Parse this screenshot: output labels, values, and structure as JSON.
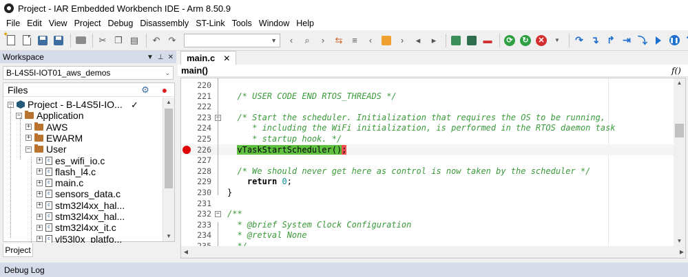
{
  "window": {
    "title": "Project - IAR Embedded Workbench IDE - Arm 8.50.9"
  },
  "menu": {
    "items": [
      "File",
      "Edit",
      "View",
      "Project",
      "Debug",
      "Disassembly",
      "ST-Link",
      "Tools",
      "Window",
      "Help"
    ]
  },
  "toolbar": {
    "combo_value": "",
    "icons": [
      "new-file-icon",
      "open-file-icon",
      "save-icon",
      "save-all-icon",
      "print-icon",
      "cut-icon",
      "copy-icon",
      "paste-icon",
      "undo-icon",
      "redo-icon",
      "find-icon",
      "replace-icon",
      "navigate-back-icon",
      "bookmark-icon",
      "build-icon",
      "compile-icon",
      "debug-icon",
      "go-icon",
      "stop-icon",
      "step-over-icon",
      "step-into-icon",
      "step-out-icon",
      "run-to-cursor-icon",
      "pause-icon"
    ]
  },
  "workspace": {
    "title": "Workspace",
    "config": "B-L4S5I-IOT01_aws_demos",
    "files_label": "Files",
    "tab": "Project",
    "tree": [
      {
        "label": "Project - B-L4S5I-IO...",
        "type": "project",
        "expander": "−",
        "depth": 0
      },
      {
        "label": "Application",
        "type": "folder",
        "expander": "−",
        "depth": 1
      },
      {
        "label": "AWS",
        "type": "folder",
        "expander": "+",
        "depth": 2
      },
      {
        "label": "EWARM",
        "type": "folder",
        "expander": "+",
        "depth": 2
      },
      {
        "label": "User",
        "type": "folder",
        "expander": "−",
        "depth": 2
      },
      {
        "label": "es_wifi_io.c",
        "type": "file",
        "expander": "+",
        "depth": 3
      },
      {
        "label": "flash_l4.c",
        "type": "file",
        "expander": "+",
        "depth": 3
      },
      {
        "label": "main.c",
        "type": "file",
        "expander": "+",
        "depth": 3
      },
      {
        "label": "sensors_data.c",
        "type": "file",
        "expander": "+",
        "depth": 3
      },
      {
        "label": "stm32l4xx_hal...",
        "type": "file",
        "expander": "+",
        "depth": 3
      },
      {
        "label": "stm32l4xx_hal...",
        "type": "file",
        "expander": "+",
        "depth": 3
      },
      {
        "label": "stm32l4xx_it.c",
        "type": "file",
        "expander": "+",
        "depth": 3
      },
      {
        "label": "vl53l0x_platfo...",
        "type": "file",
        "expander": "+",
        "depth": 3
      }
    ]
  },
  "editor": {
    "tab_label": "main.c",
    "function_name": "main()",
    "function_icon": "f()",
    "lines": [
      {
        "num": "220",
        "text": ""
      },
      {
        "num": "221",
        "text": "  /* USER CODE END RTOS_THREADS */"
      },
      {
        "num": "222",
        "text": ""
      },
      {
        "num": "223",
        "text": "  /* Start the scheduler. Initialization that requires the OS to be running,"
      },
      {
        "num": "224",
        "text": "     * including the WiFi initialization, is performed in the RTOS daemon task"
      },
      {
        "num": "225",
        "text": "     * startup hook. */"
      },
      {
        "num": "226",
        "text": "vTaskStartScheduler();"
      },
      {
        "num": "227",
        "text": ""
      },
      {
        "num": "228",
        "text": "  /* We should never get here as control is now taken by the scheduler */"
      },
      {
        "num": "229",
        "text": "    return 0;"
      },
      {
        "num": "230",
        "text": "}"
      },
      {
        "num": "231",
        "text": ""
      },
      {
        "num": "232",
        "text": "/**"
      },
      {
        "num": "233",
        "text": "  * @brief System Clock Configuration"
      },
      {
        "num": "234",
        "text": "  * @retval None"
      },
      {
        "num": "235",
        "text": "  */"
      }
    ]
  },
  "debug_log": {
    "label": "Debug Log"
  },
  "colors": {
    "comment": "#3a9a3a",
    "breakpoint": "#e00000",
    "highlight_green": "#5fc13f",
    "highlight_red": "#ef4f4f",
    "panel_header": "#d6dbe9"
  }
}
